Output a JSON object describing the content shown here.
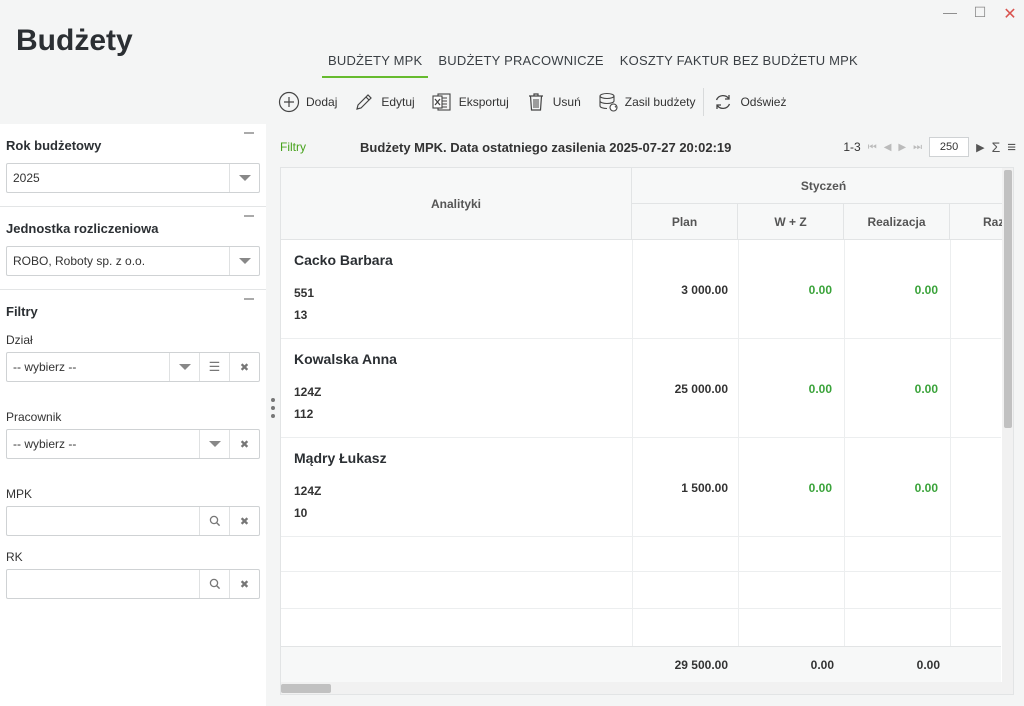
{
  "window": {
    "minimize": "—",
    "maximize": "☐",
    "close": "✕"
  },
  "app": {
    "title": "Budżety"
  },
  "tabs": [
    {
      "label": "BUDŻETY MPK",
      "active": true
    },
    {
      "label": "BUDŻETY PRACOWNICZE",
      "active": false
    },
    {
      "label": "KOSZTY FAKTUR BEZ BUDŻETU MPK",
      "active": false
    }
  ],
  "toolbar": {
    "add": "Dodaj",
    "edit": "Edytuj",
    "export": "Eksportuj",
    "delete": "Usuń",
    "fund": "Zasil budżety",
    "refresh": "Odśwież"
  },
  "sidebar": {
    "year": {
      "title": "Rok budżetowy",
      "value": "2025"
    },
    "unit": {
      "title": "Jednostka rozliczeniowa",
      "value": "ROBO, Roboty sp. z o.o."
    },
    "filters": {
      "title": "Filtry",
      "dept": {
        "label": "Dział",
        "placeholder": "-- wybierz --"
      },
      "employee": {
        "label": "Pracownik",
        "placeholder": "-- wybierz --"
      },
      "mpk": {
        "label": "MPK",
        "value": ""
      },
      "rk": {
        "label": "RK",
        "value": ""
      }
    }
  },
  "main": {
    "filters_link": "Filtry",
    "grid_title": "Budżety MPK. Data ostatniego zasilenia 2025-07-27 20:02:19",
    "pager": {
      "range": "1-3",
      "page_size": "250",
      "sum_icon": "Σ",
      "menu_icon": "≡"
    }
  },
  "grid": {
    "col_analytics": "Analityki",
    "month": "Styczeń",
    "sub_cols": [
      "Plan",
      "W + Z",
      "Realizacja",
      "Raz"
    ],
    "rows": [
      {
        "name": "Cacko Barbara",
        "code1": "551",
        "code2": "13",
        "plan": "3 000.00",
        "wz": "0.00",
        "real": "0.00"
      },
      {
        "name": "Kowalska Anna",
        "code1": "124Z",
        "code2": "112",
        "plan": "25 000.00",
        "wz": "0.00",
        "real": "0.00"
      },
      {
        "name": "Mądry Łukasz",
        "code1": "124Z",
        "code2": "10",
        "plan": "1 500.00",
        "wz": "0.00",
        "real": "0.00"
      }
    ],
    "totals": {
      "plan": "29 500.00",
      "wz": "0.00",
      "real": "0.00"
    }
  },
  "colors": {
    "accent_green": "#66bb2e",
    "value_green": "#3aa33a",
    "link_green": "#46a21b"
  }
}
